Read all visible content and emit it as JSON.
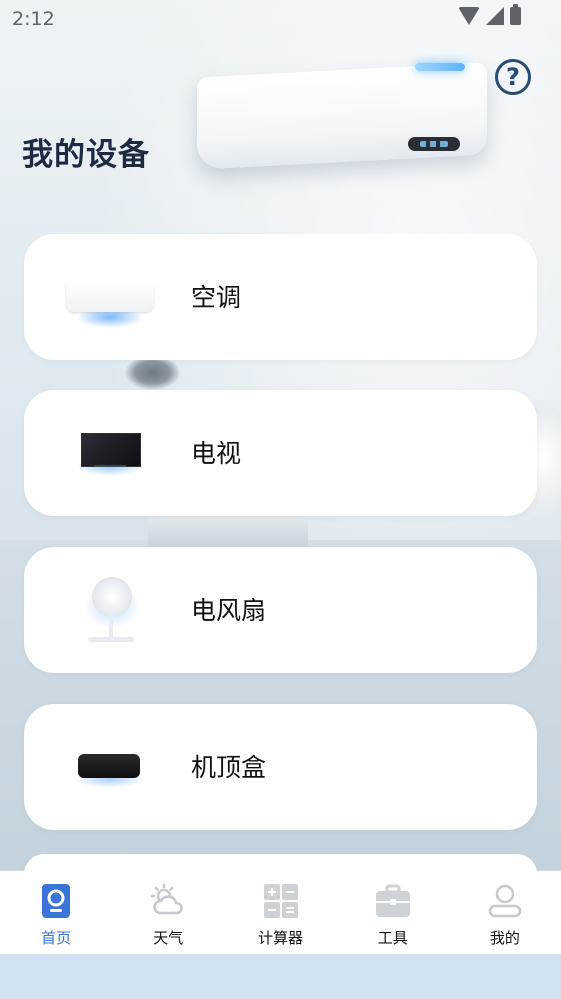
{
  "status_bar": {
    "time": "2:12",
    "icons": [
      "wifi-icon",
      "signal-icon",
      "battery-icon"
    ]
  },
  "header": {
    "title": "我的设备",
    "help_icon": "question-circle-icon",
    "help_symbol": "?"
  },
  "devices": [
    {
      "name": "空调",
      "icon": "air-conditioner-icon"
    },
    {
      "name": "电视",
      "icon": "tv-icon"
    },
    {
      "name": "电风扇",
      "icon": "fan-icon"
    },
    {
      "name": "机顶盒",
      "icon": "set-top-box-icon"
    }
  ],
  "tab_bar": {
    "items": [
      {
        "label": "首页",
        "icon": "home-icon",
        "active": true
      },
      {
        "label": "天气",
        "icon": "weather-icon",
        "active": false
      },
      {
        "label": "计算器",
        "icon": "calculator-icon",
        "active": false
      },
      {
        "label": "工具",
        "icon": "toolbox-icon",
        "active": false
      },
      {
        "label": "我的",
        "icon": "profile-icon",
        "active": false
      }
    ]
  },
  "colors": {
    "accent": "#3b73d9",
    "title": "#1d2a44",
    "tab_inactive_icon": "#c9ced3",
    "bottom_bar": "#d3e2f3"
  }
}
